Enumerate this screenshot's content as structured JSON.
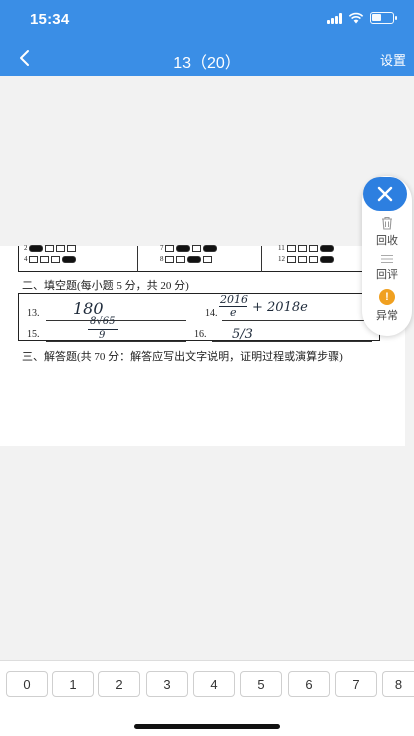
{
  "status_bar": {
    "time": "15:34"
  },
  "nav": {
    "title": "13（20）",
    "settings_label": "设置"
  },
  "paper": {
    "mc_rows_left": [
      {
        "num": "2",
        "options": [
          "A",
          "B",
          "C",
          "D"
        ]
      },
      {
        "num": "4",
        "options": [
          "A",
          "B",
          "C",
          "D"
        ]
      }
    ],
    "mc_rows_mid": [
      {
        "num": "7",
        "options": [
          "A",
          "B",
          "C",
          "D"
        ]
      },
      {
        "num": "8",
        "options": [
          "A",
          "B",
          "C",
          "D"
        ]
      }
    ],
    "mc_rows_right": [
      {
        "num": "11",
        "options": [
          "A",
          "B",
          "C",
          "D"
        ]
      },
      {
        "num": "12",
        "options": [
          "A",
          "B",
          "C",
          "D"
        ]
      }
    ],
    "section2_title": "二、填空题(每小题 5 分，共 20 分)",
    "q13": "13.",
    "q14": "14.",
    "q15": "15.",
    "q16": "16.",
    "ans13": "180",
    "ans14_num": "2016",
    "ans14_den": "e",
    "ans14_rest": "+ 2018e",
    "ans15_num": "8√65",
    "ans15_den": "9",
    "ans16": "5/3",
    "section3_title": "三、解答题(共 70 分：解答应写出文字说明，证明过程或演算步骤)"
  },
  "float_panel": {
    "recycle_label": "回收",
    "review_label": "回评",
    "abnormal_label": "异常",
    "abnormal_mark": "!"
  },
  "score_keys": [
    "0",
    "1",
    "2",
    "3",
    "4",
    "5",
    "6",
    "7",
    "8"
  ],
  "colors": {
    "header_blue": "#3a8ee6",
    "close_blue": "#2d7fe0",
    "warn_orange": "#f0a020"
  }
}
